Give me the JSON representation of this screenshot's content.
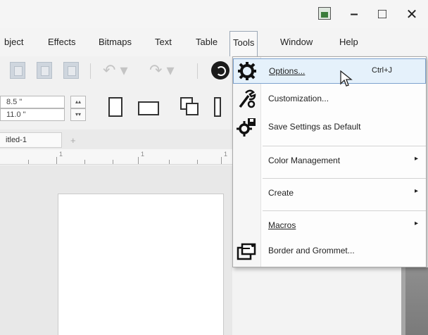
{
  "titlebar": {
    "minimize": "–",
    "maximize": "□",
    "close": "✕"
  },
  "menubar": {
    "items": [
      {
        "label": "bject"
      },
      {
        "label": "Effects"
      },
      {
        "label": "Bitmaps"
      },
      {
        "label": "Text"
      },
      {
        "label": "Table"
      },
      {
        "label": "Tools"
      },
      {
        "label": "Window"
      },
      {
        "label": "Help"
      }
    ]
  },
  "toolbar": {
    "undo_icon": "undo-icon",
    "redo_icon": "redo-icon"
  },
  "propbar": {
    "width_value": "8.5 \"",
    "height_value": "11.0 \""
  },
  "document": {
    "tab_label": "itled-1",
    "add_tab": "+"
  },
  "ruler": {
    "numbers": [
      "1",
      "1",
      "1"
    ]
  },
  "tools_menu": {
    "items": [
      {
        "label": "Options...",
        "shortcut": "Ctrl+J",
        "icon": "gear-icon"
      },
      {
        "label": "Customization...",
        "icon": "wrench-icon"
      },
      {
        "label": "Save Settings as Default",
        "icon": "gear-save-icon"
      },
      {
        "label": "Color Management"
      },
      {
        "label": "Create"
      },
      {
        "label": "Macros"
      },
      {
        "label": "Border and Grommet...",
        "icon": "border-grommet-icon"
      }
    ]
  }
}
